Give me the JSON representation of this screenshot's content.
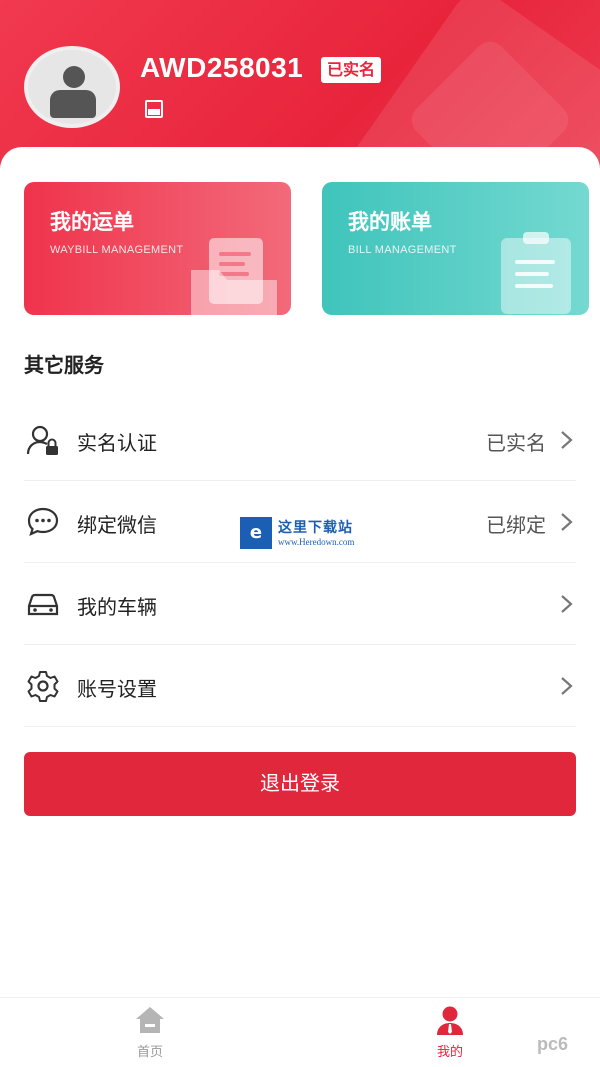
{
  "header": {
    "username": "AWD258031",
    "verified_badge": "已实名"
  },
  "cards": [
    {
      "title": "我的运单",
      "subtitle": "WAYBILL MANAGEMENT",
      "color": "#f0334c"
    },
    {
      "title": "我的账单",
      "subtitle": "BILL MANAGEMENT",
      "color": "#3fc4bb"
    }
  ],
  "section_title": "其它服务",
  "menu": [
    {
      "label": "实名认证",
      "value": "已实名",
      "icon": "user-lock-icon"
    },
    {
      "label": "绑定微信",
      "value": "已绑定",
      "icon": "chat-icon"
    },
    {
      "label": "我的车辆",
      "value": "",
      "icon": "car-icon"
    },
    {
      "label": "账号设置",
      "value": "",
      "icon": "gear-icon"
    }
  ],
  "logout_label": "退出登录",
  "watermark": {
    "title": "这里下载站",
    "url": "www.Heredown.com"
  },
  "nav": [
    {
      "label": "首页",
      "icon": "home-icon",
      "active": false
    },
    {
      "label": "我的",
      "icon": "person-icon",
      "active": true
    }
  ],
  "corner_watermark": "pc6",
  "colors": {
    "accent": "#e1273c",
    "teal": "#3fc4bb"
  }
}
